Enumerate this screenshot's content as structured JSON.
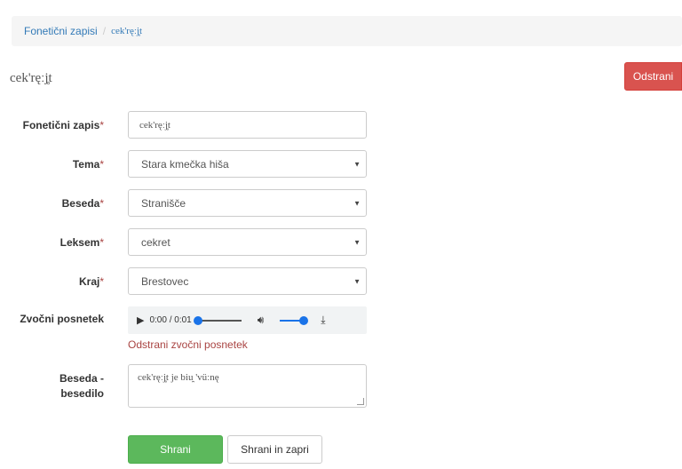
{
  "breadcrumb": {
    "root": "Fonetični zapisi",
    "separator": "/",
    "current": "cek'ręːj̥t"
  },
  "title": "cek'ręːj̥t",
  "delete_button": "Odstrani",
  "fields": {
    "phonetic": {
      "label": "Fonetični zapis",
      "required": "*",
      "value": "cek'ręːj̥t"
    },
    "theme": {
      "label": "Tema",
      "required": "*",
      "value": "Stara kmečka hiša"
    },
    "word": {
      "label": "Beseda",
      "required": "*",
      "value": "Stranišče"
    },
    "lexeme": {
      "label": "Leksem",
      "required": "*",
      "value": "cekret"
    },
    "region": {
      "label": "Kraj",
      "required": "*",
      "value": "Brestovec"
    }
  },
  "audio": {
    "label": "Zvočni posnetek",
    "time": "0:00 / 0:01",
    "progress": 0,
    "volume": 1,
    "remove_link": "Odstrani zvočni posnetek"
  },
  "text": {
    "label_line1": "Beseda -",
    "label_line2": "besedilo",
    "value": "cek'ręːj̥t je biu̯ 'vüːnę"
  },
  "buttons": {
    "save": "Shrani",
    "save_close": "Shrani in zapri"
  }
}
